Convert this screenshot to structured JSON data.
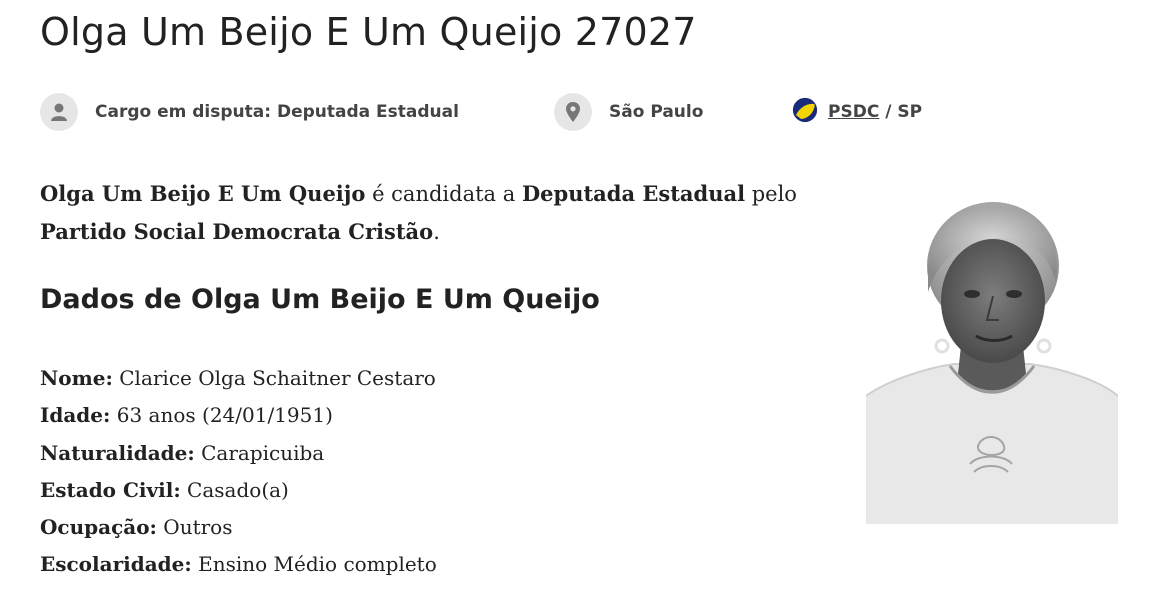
{
  "candidate": {
    "title": "Olga Um Beijo E Um Queijo 27027",
    "meta": {
      "cargo": "Cargo em disputa: Deputada Estadual",
      "location": "São Paulo",
      "party_abbr": "PSDC",
      "party_suffix": " / SP"
    },
    "intro": {
      "name": "Olga Um Beijo E Um Queijo",
      "text1": " é candidata a ",
      "office": "Deputada Estadual",
      "text2": " pelo ",
      "party_full": "Partido Social Democrata Cristão",
      "end": "."
    },
    "section_title": "Dados de Olga Um Beijo E Um Queijo",
    "details": [
      {
        "label": "Nome:",
        "value": " Clarice Olga Schaitner Cestaro"
      },
      {
        "label": "Idade:",
        "value": " 63 anos (24/01/1951)"
      },
      {
        "label": "Naturalidade:",
        "value": " Carapicuiba"
      },
      {
        "label": "Estado Civil:",
        "value": " Casado(a)"
      },
      {
        "label": "Ocupação:",
        "value": " Outros"
      },
      {
        "label": "Escolaridade:",
        "value": " Ensino Médio completo"
      }
    ]
  },
  "icons": {
    "cargo": "person-icon",
    "location": "map-pin-icon",
    "party": "party-logo-icon"
  },
  "colors": {
    "icon_bg": "#e6e6e6",
    "icon_fg": "#777777",
    "party_blue": "#1a2a7a",
    "party_yellow": "#f2d400"
  }
}
